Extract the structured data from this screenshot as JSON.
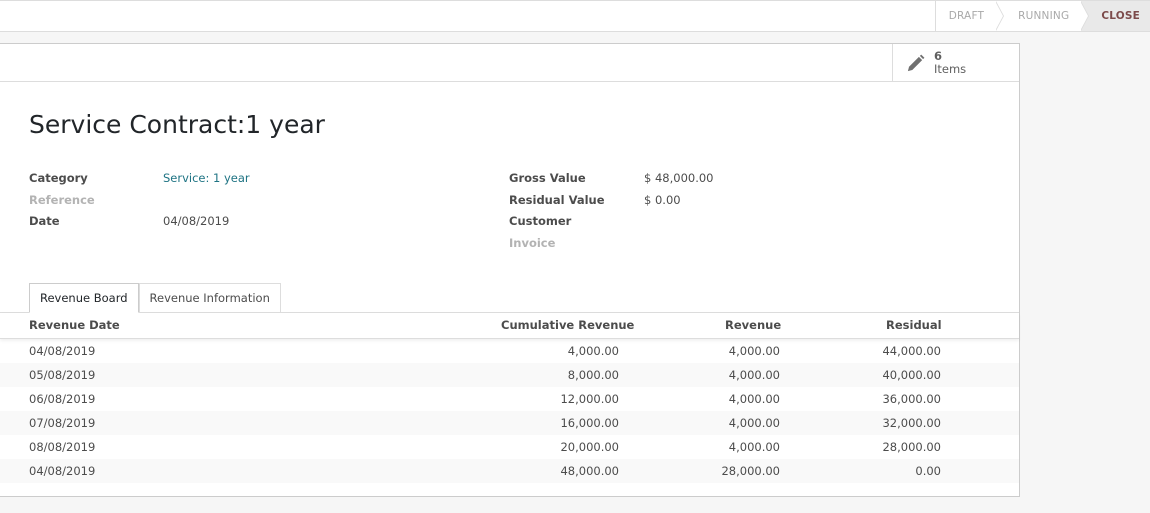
{
  "statusbar": {
    "stages": [
      "DRAFT",
      "RUNNING",
      "CLOSE"
    ],
    "active_stage": "CLOSE"
  },
  "buttonbox": {
    "items_count": "6",
    "items_label": "Items",
    "icon": "pencil-icon"
  },
  "form": {
    "title": "Service Contract:1 year",
    "left": [
      {
        "label": "Category",
        "value": "Service: 1 year"
      },
      {
        "label": "Reference",
        "value": ""
      },
      {
        "label": "Date",
        "value": "04/08/2019"
      }
    ],
    "right": [
      {
        "label": "Gross Value",
        "value": "$ 48,000.00"
      },
      {
        "label": "Residual Value",
        "value": "$ 0.00"
      },
      {
        "label": "Customer",
        "value": ""
      },
      {
        "label": "Invoice",
        "value": ""
      }
    ]
  },
  "tabs": [
    "Revenue Board",
    "Revenue Information"
  ],
  "table": {
    "headers": [
      "Revenue Date",
      "Cumulative Revenue",
      "Revenue",
      "Residual"
    ],
    "rows": [
      [
        "04/08/2019",
        "4,000.00",
        "4,000.00",
        "44,000.00"
      ],
      [
        "05/08/2019",
        "8,000.00",
        "4,000.00",
        "40,000.00"
      ],
      [
        "06/08/2019",
        "12,000.00",
        "4,000.00",
        "36,000.00"
      ],
      [
        "07/08/2019",
        "16,000.00",
        "4,000.00",
        "32,000.00"
      ],
      [
        "08/08/2019",
        "20,000.00",
        "4,000.00",
        "28,000.00"
      ],
      [
        "04/08/2019",
        "48,000.00",
        "28,000.00",
        "0.00"
      ]
    ]
  },
  "colors": {
    "link": "#1e7383",
    "active_stage": "#7c4a4a"
  }
}
